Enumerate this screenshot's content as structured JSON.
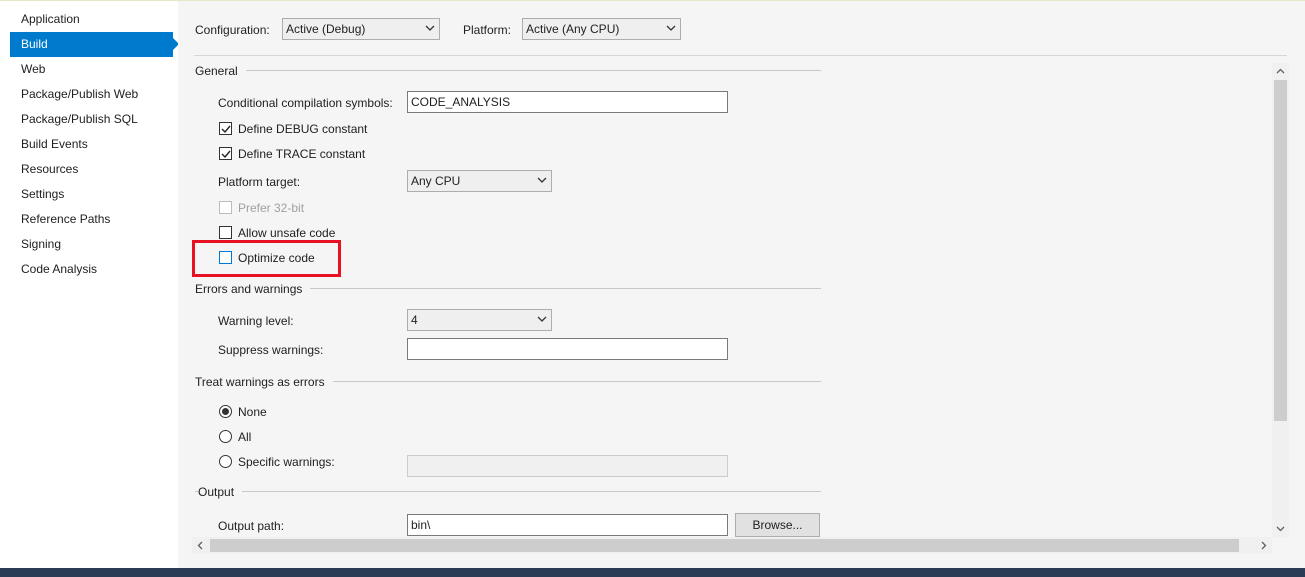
{
  "sidebar": {
    "items": [
      {
        "label": "Application"
      },
      {
        "label": "Build"
      },
      {
        "label": "Web"
      },
      {
        "label": "Package/Publish Web"
      },
      {
        "label": "Package/Publish SQL"
      },
      {
        "label": "Build Events"
      },
      {
        "label": "Resources"
      },
      {
        "label": "Settings"
      },
      {
        "label": "Reference Paths"
      },
      {
        "label": "Signing"
      },
      {
        "label": "Code Analysis"
      }
    ],
    "active": "Build"
  },
  "header": {
    "configuration_label": "Configuration:",
    "configuration_value": "Active (Debug)",
    "platform_label": "Platform:",
    "platform_value": "Active (Any CPU)"
  },
  "general": {
    "title": "General",
    "symbols_label": "Conditional compilation symbols:",
    "symbols_value": "CODE_ANALYSIS",
    "define_debug_label": "Define DEBUG constant",
    "define_debug_checked": true,
    "define_trace_label": "Define TRACE constant",
    "define_trace_checked": true,
    "platform_target_label": "Platform target:",
    "platform_target_value": "Any CPU",
    "prefer32_label": "Prefer 32-bit",
    "prefer32_checked": false,
    "unsafe_label": "Allow unsafe code",
    "unsafe_checked": false,
    "optimize_label": "Optimize code",
    "optimize_checked": false
  },
  "errors": {
    "title": "Errors and warnings",
    "warning_level_label": "Warning level:",
    "warning_level_value": "4",
    "suppress_label": "Suppress warnings:",
    "suppress_value": ""
  },
  "treat": {
    "title": "Treat warnings as errors",
    "none_label": "None",
    "all_label": "All",
    "specific_label": "Specific warnings:",
    "selected": "None",
    "specific_value": ""
  },
  "output": {
    "title": "Output",
    "path_label": "Output path:",
    "path_value": "bin\\",
    "browse_label": "Browse..."
  },
  "icons": {
    "dropdown": "chevron-down-icon",
    "check": "checkmark-icon"
  },
  "colors": {
    "accent": "#007acc",
    "highlight": "#e81123"
  }
}
